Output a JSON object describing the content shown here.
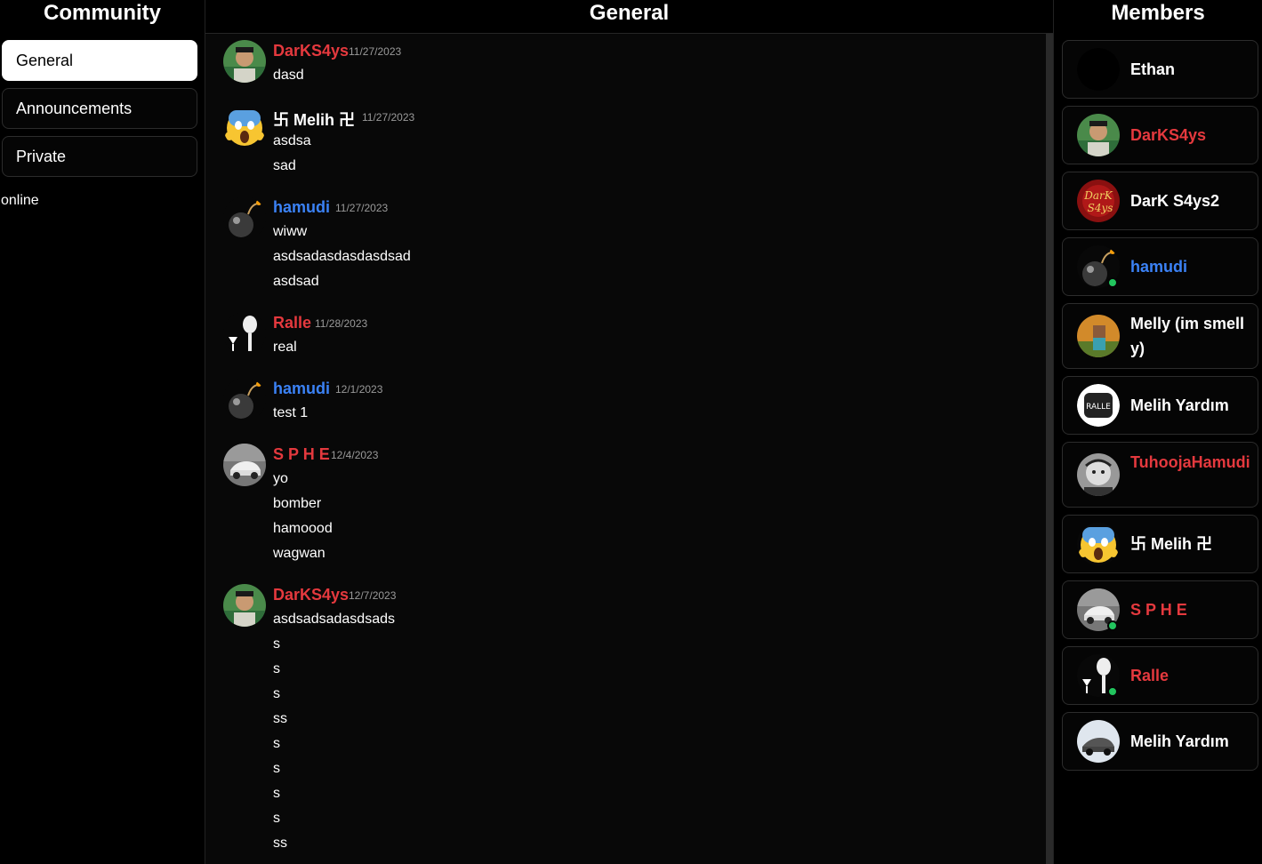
{
  "sidebar": {
    "title": "Community",
    "channels": [
      {
        "label": "General",
        "active": true
      },
      {
        "label": "Announcements",
        "active": false
      },
      {
        "label": "Private",
        "active": false
      }
    ],
    "status": "online"
  },
  "chat": {
    "title": "General",
    "groups": [
      {
        "user": "DarKS4ys",
        "color": "red",
        "avatar": "photo-man-avatar",
        "date": "11/27/2023",
        "lines": [
          "dasd"
        ]
      },
      {
        "user": "卐 Melih 卍",
        "color": "white",
        "avatar": "scream-emoji-avatar",
        "date": "11/27/2023",
        "lines": [
          "asdsa",
          "sad"
        ]
      },
      {
        "user": "hamudi",
        "color": "blue",
        "avatar": "bomb-avatar",
        "date": "11/27/2023",
        "lines": [
          "wiww",
          "asdsadasdasdasdsad",
          "asdsad"
        ]
      },
      {
        "user": "Ralle",
        "color": "red",
        "avatar": "meme-avatar",
        "date": "11/28/2023",
        "lines": [
          "real"
        ]
      },
      {
        "user": "hamudi",
        "color": "blue",
        "avatar": "bomb-avatar",
        "date": "12/1/2023",
        "lines": [
          "test 1"
        ]
      },
      {
        "user": "S P H E",
        "color": "red",
        "avatar": "car-avatar",
        "date": "12/4/2023",
        "lines": [
          "yo",
          "bomber",
          "hamoood",
          "wagwan"
        ]
      },
      {
        "user": "DarKS4ys",
        "color": "red",
        "avatar": "photo-man-avatar",
        "date": "12/7/2023",
        "lines": [
          "asdsadsadasdsads",
          "s",
          "s",
          "s",
          "ss",
          "s",
          "s",
          "s",
          "s",
          "ss"
        ]
      }
    ]
  },
  "members": {
    "title": "Members",
    "list": [
      {
        "name": "Ethan",
        "color": "white",
        "avatar": "black-avatar",
        "online": false
      },
      {
        "name": "DarKS4ys",
        "color": "red",
        "avatar": "photo-man-avatar",
        "online": false
      },
      {
        "name": "DarK S4ys2",
        "color": "white",
        "avatar": "logo-avatar",
        "online": false
      },
      {
        "name": "hamudi",
        "color": "blue",
        "avatar": "bomb-avatar",
        "online": true
      },
      {
        "name": "Melly (im smelly)",
        "color": "white",
        "avatar": "minecraft-avatar",
        "online": false
      },
      {
        "name": "Melih Yardım",
        "color": "white",
        "avatar": "badge-avatar",
        "online": false
      },
      {
        "name": "TuhoojaHamudi",
        "color": "red",
        "avatar": "sketch-avatar",
        "online": false
      },
      {
        "name": "卐 Melih 卍",
        "color": "white",
        "avatar": "scream-emoji-avatar",
        "online": false
      },
      {
        "name": "S P H E",
        "color": "red",
        "avatar": "car-avatar",
        "online": true
      },
      {
        "name": "Ralle",
        "color": "red",
        "avatar": "meme-avatar",
        "online": true
      },
      {
        "name": "Melih Yardım",
        "color": "white",
        "avatar": "car-white-avatar",
        "online": false
      }
    ]
  },
  "colors": {
    "red": "#e5393e",
    "blue": "#3b82f6",
    "white": "#ffffff",
    "online": "#22c55e"
  }
}
